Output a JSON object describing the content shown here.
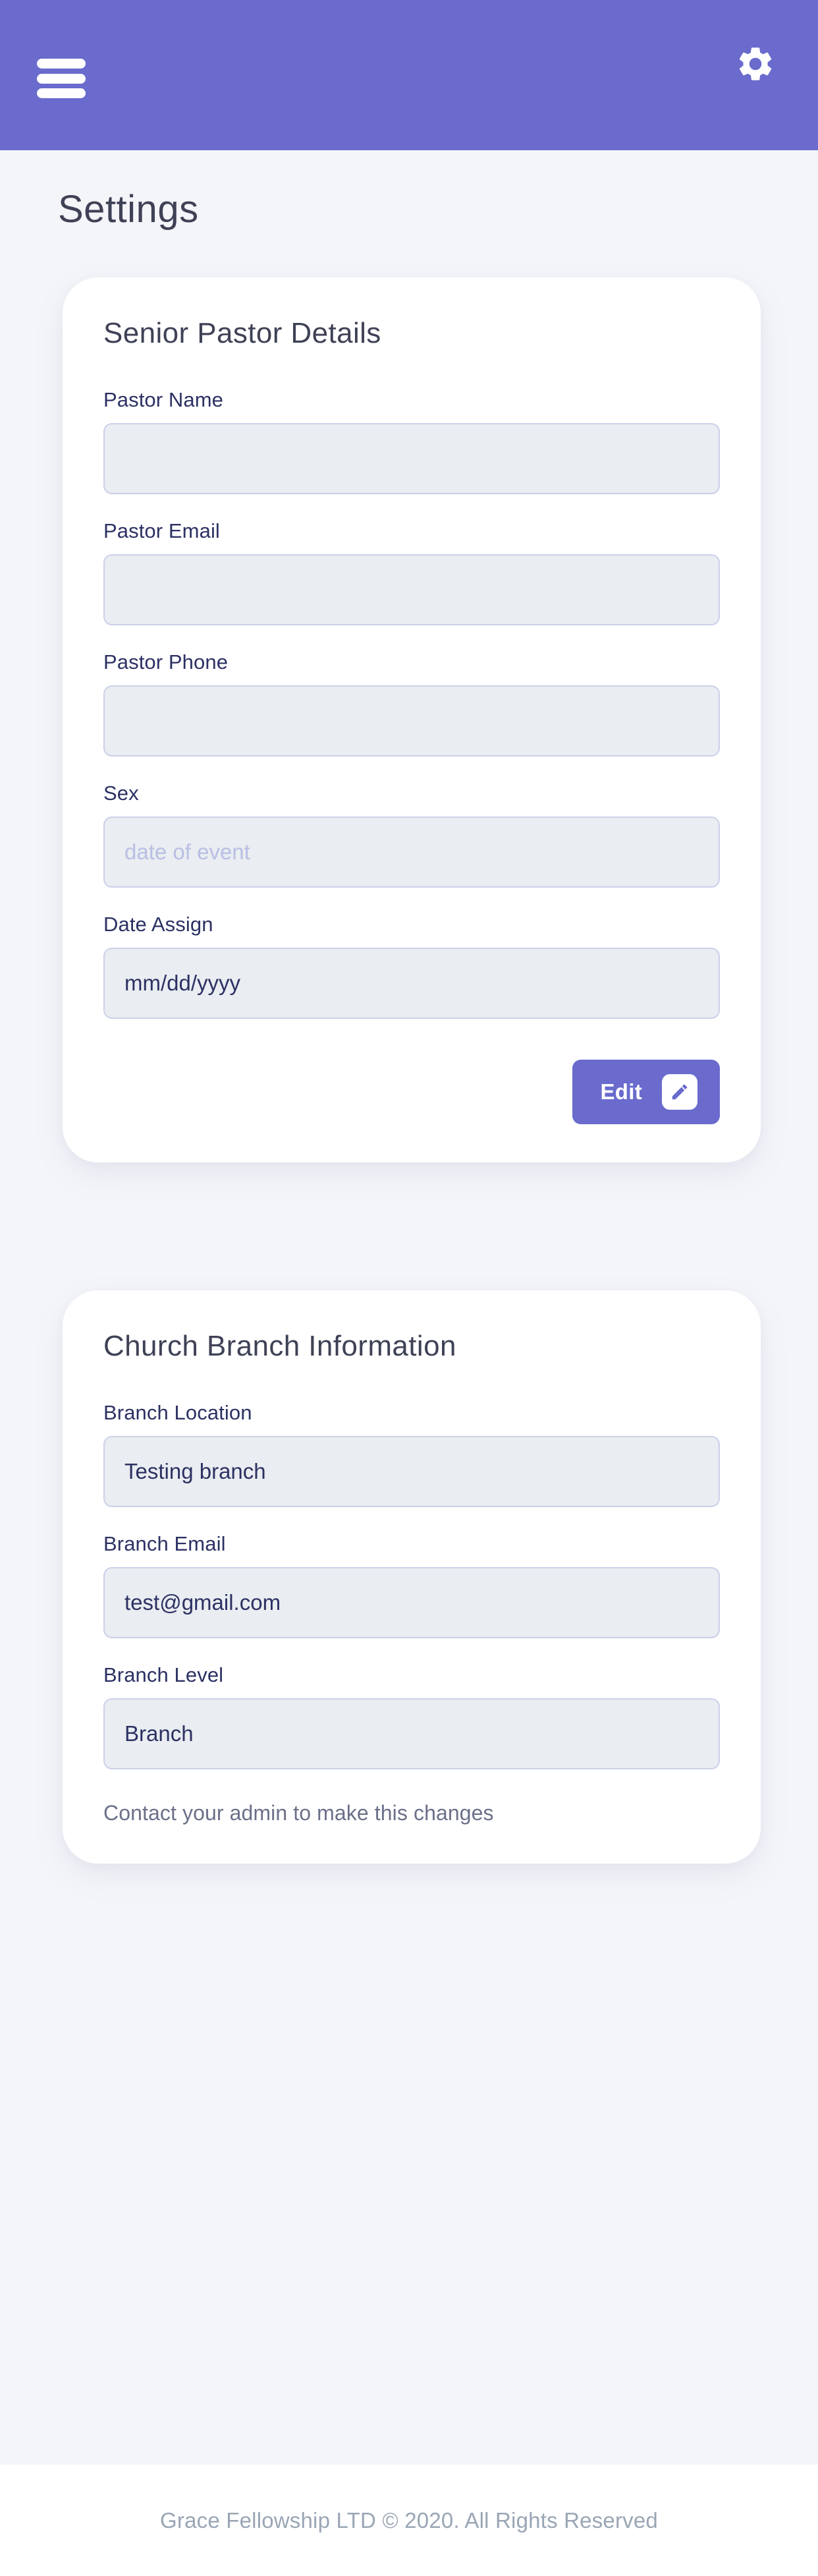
{
  "header": {
    "menu_icon": "hamburger-menu-icon",
    "settings_icon": "gear-icon"
  },
  "page_title": "Settings",
  "cards": [
    {
      "title": "Senior Pastor Details",
      "fields": [
        {
          "label": "Pastor Name",
          "value": "",
          "placeholder": ""
        },
        {
          "label": "Pastor Email",
          "value": "",
          "placeholder": ""
        },
        {
          "label": "Pastor Phone",
          "value": "",
          "placeholder": ""
        },
        {
          "label": "Sex",
          "value": "",
          "placeholder": "date of event"
        },
        {
          "label": "Date Assign",
          "value": "mm/dd/yyyy",
          "placeholder": "mm/dd/yyyy"
        }
      ],
      "action": {
        "label": "Edit",
        "icon": "pencil-edit-icon"
      }
    },
    {
      "title": "Church Branch Information",
      "fields": [
        {
          "label": "Branch Location",
          "value": "Testing branch",
          "placeholder": ""
        },
        {
          "label": "Branch Email",
          "value": "test@gmail.com",
          "placeholder": ""
        },
        {
          "label": "Branch Level",
          "value": "Branch",
          "placeholder": ""
        }
      ],
      "helper_text": "Contact your admin to make this changes"
    }
  ],
  "footer": {
    "text": "Grace Fellowship LTD © 2020. All Rights Reserved"
  },
  "colors": {
    "accent": "#6a6bcd",
    "page_background": "#f4f5f9",
    "card_background": "#ffffff",
    "input_background": "#eaedf1",
    "input_border": "#ccd1e9",
    "label_text": "#2c3163",
    "title_text": "#3f4256",
    "placeholder_text": "#b9bfe4",
    "footer_text": "#9aa6b5",
    "helper_text": "#6b7089"
  }
}
